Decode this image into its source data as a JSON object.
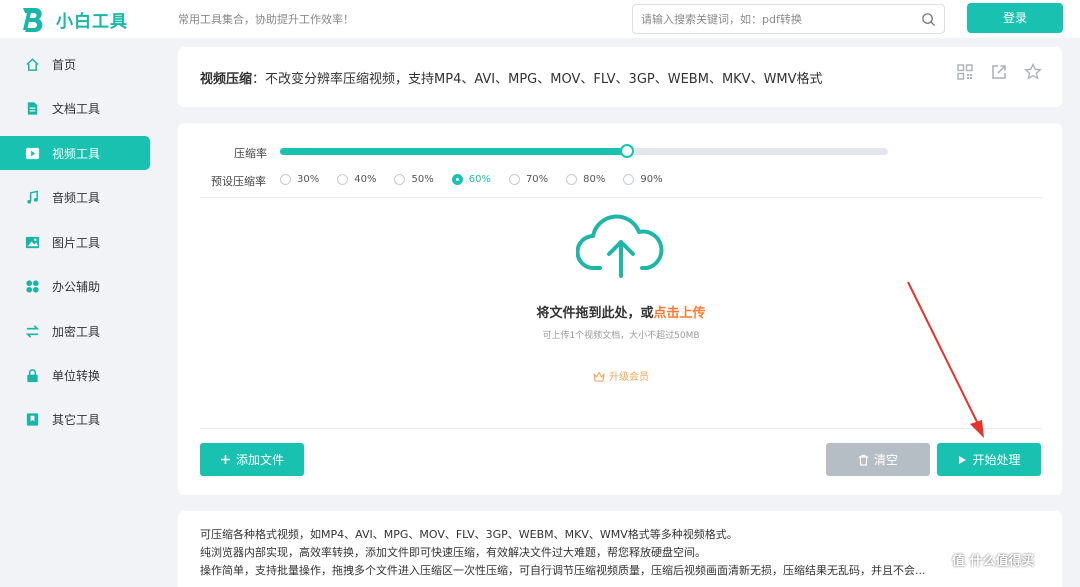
{
  "header": {
    "logo_text": "小白工具",
    "slogan": "常用工具集合，协助提升工作效率！",
    "search_placeholder": "请输入搜索关键词，如：pdf转换",
    "login_label": "登录"
  },
  "sidebar": {
    "items": [
      {
        "label": "首页",
        "icon": "home-icon"
      },
      {
        "label": "文档工具",
        "icon": "document-icon"
      },
      {
        "label": "视频工具",
        "icon": "video-icon",
        "active": true
      },
      {
        "label": "音频工具",
        "icon": "music-icon"
      },
      {
        "label": "图片工具",
        "icon": "image-icon"
      },
      {
        "label": "办公辅助",
        "icon": "office-icon"
      },
      {
        "label": "加密工具",
        "icon": "encrypt-icon"
      },
      {
        "label": "单位转换",
        "icon": "unit-icon"
      },
      {
        "label": "其它工具",
        "icon": "bookmark-icon"
      }
    ]
  },
  "title_card": {
    "title": "视频压缩",
    "description": "：不改变分辨率压缩视频，支持MP4、AVI、MPG、MOV、FLV、3GP、WEBM、MKV、WMV格式",
    "actions": [
      "qrcode-icon",
      "share-icon",
      "star-icon"
    ]
  },
  "compress": {
    "rate_label": "压缩率",
    "rate_value": 0.57,
    "preset_label": "预设压缩率",
    "presets": [
      "30%",
      "40%",
      "50%",
      "60%",
      "70%",
      "80%",
      "90%"
    ],
    "selected_preset": "60%"
  },
  "upload": {
    "drop_text": "将文件拖到此处，或",
    "drop_link": "点击上传",
    "hint": "可上传1个视频文档，大小不超过50MB",
    "vip_label": "升级会员"
  },
  "buttons": {
    "add_label": "添加文件",
    "clear_label": "清空",
    "start_label": "开始处理"
  },
  "description_lines": [
    "可压缩各种格式视频，如MP4、AVI、MPG、MOV、FLV、3GP、WEBM、MKV、WMV格式等多种视频格式。",
    "纯浏览器内部实现，高效率转换，添加文件即可快速压缩，有效解决文件过大难题，帮您释放硬盘空间。",
    "操作简单，支持批量操作，拖拽多个文件进入压缩区一次性压缩，可自行调节压缩视频质量，压缩后视频画面清新无损，压缩结果无乱码，并且不会..."
  ],
  "watermark": "值 什么值得买",
  "colors": {
    "accent": "#19c2b0",
    "link": "#ff7a2f",
    "vip": "#f3a55a",
    "annotation_arrow": "#e8332a"
  }
}
